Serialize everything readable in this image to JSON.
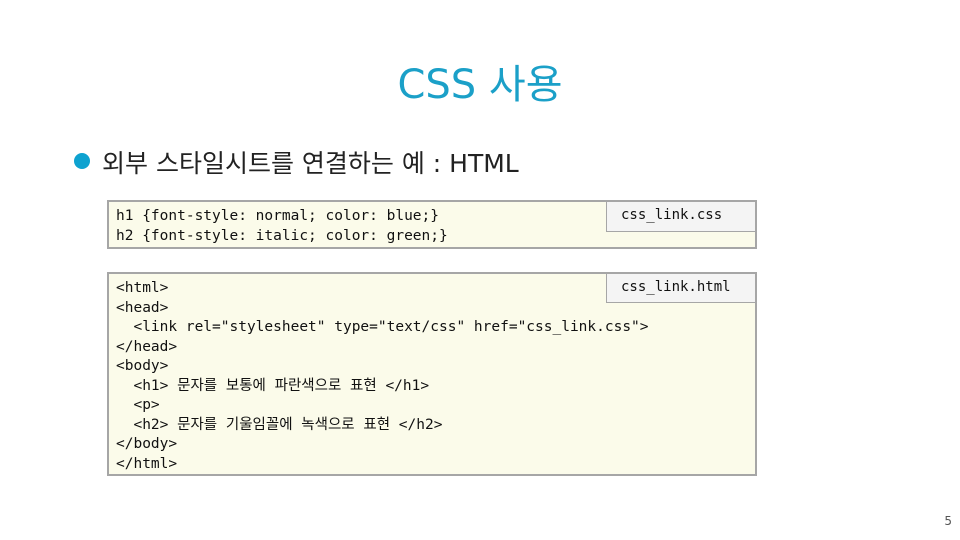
{
  "slide": {
    "title": "CSS 사용",
    "bullet": "외부 스타일시트를 연결하는 예 : HTML",
    "page_number": "5"
  },
  "css_box": {
    "filename": "css_link.css",
    "code": "h1 {font-style: normal; color: blue;}\nh2 {font-style: italic; color: green;}"
  },
  "html_box": {
    "filename": "css_link.html",
    "code": "<html>\n<head>\n  <link rel=\"stylesheet\" type=\"text/css\" href=\"css_link.css\">\n</head>\n<body>\n  <h1> 문자를 보통에 파란색으로 표현 </h1>\n  <p>\n  <h2> 문자를 기울임꼴에 녹색으로 표현 </h2>\n</body>\n</html>"
  },
  "colors": {
    "title": "#1ba0c8",
    "bullet": "#0ea2d0",
    "code_background": "#fbfbea",
    "border": "#a6a6a6"
  }
}
